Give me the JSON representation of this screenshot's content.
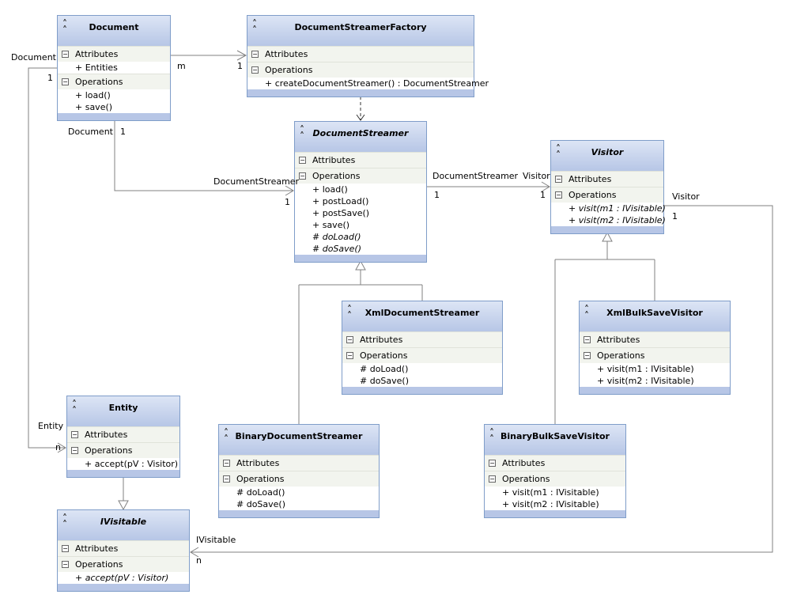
{
  "classes": [
    {
      "id": "document",
      "name": "Document",
      "abstract": false,
      "attributes_label": "Attributes",
      "attributes": [
        {
          "text": "+ Entities"
        }
      ],
      "operations_label": "Operations",
      "operations": [
        {
          "text": "+ load()"
        },
        {
          "text": "+ save()"
        }
      ]
    },
    {
      "id": "factory",
      "name": "DocumentStreamerFactory",
      "abstract": false,
      "attributes_label": "Attributes",
      "attributes": [],
      "operations_label": "Operations",
      "operations": [
        {
          "text": "+ createDocumentStreamer() : DocumentStreamer"
        }
      ]
    },
    {
      "id": "streamer",
      "name": "DocumentStreamer",
      "abstract": true,
      "attributes_label": "Attributes",
      "attributes": [],
      "operations_label": "Operations",
      "operations": [
        {
          "text": "+ load()"
        },
        {
          "text": "+ postLoad()"
        },
        {
          "text": "+ postSave()"
        },
        {
          "text": "+ save()"
        },
        {
          "text": "# doLoad()",
          "italic": true
        },
        {
          "text": "# doSave()",
          "italic": true
        }
      ]
    },
    {
      "id": "visitor",
      "name": "Visitor",
      "abstract": true,
      "attributes_label": "Attributes",
      "attributes": [],
      "operations_label": "Operations",
      "operations": [
        {
          "text": "+ visit(m1 : IVisitable)",
          "italic": true
        },
        {
          "text": "+ visit(m2 : IVisitable)",
          "italic": true
        }
      ]
    },
    {
      "id": "xmlstreamer",
      "name": "XmlDocumentStreamer",
      "abstract": false,
      "attributes_label": "Attributes",
      "attributes": [],
      "operations_label": "Operations",
      "operations": [
        {
          "text": "# doLoad()"
        },
        {
          "text": "# doSave()"
        }
      ]
    },
    {
      "id": "xmlvisitor",
      "name": "XmlBulkSaveVisitor",
      "abstract": false,
      "attributes_label": "Attributes",
      "attributes": [],
      "operations_label": "Operations",
      "operations": [
        {
          "text": "+ visit(m1 : IVisitable)"
        },
        {
          "text": "+ visit(m2 : IVisitable)"
        }
      ]
    },
    {
      "id": "entity",
      "name": "Entity",
      "abstract": false,
      "attributes_label": "Attributes",
      "attributes": [],
      "operations_label": "Operations",
      "operations": [
        {
          "text": "+ accept(pV : Visitor)"
        }
      ]
    },
    {
      "id": "binstreamer",
      "name": "BinaryDocumentStreamer",
      "abstract": false,
      "attributes_label": "Attributes",
      "attributes": [],
      "operations_label": "Operations",
      "operations": [
        {
          "text": "# doLoad()"
        },
        {
          "text": "# doSave()"
        }
      ]
    },
    {
      "id": "binvisitor",
      "name": "BinaryBulkSaveVisitor",
      "abstract": false,
      "attributes_label": "Attributes",
      "attributes": [],
      "operations_label": "Operations",
      "operations": [
        {
          "text": "+ visit(m1 : IVisitable)"
        },
        {
          "text": "+ visit(m2 : IVisitable)"
        }
      ]
    },
    {
      "id": "ivisitable",
      "name": "IVisitable",
      "abstract": true,
      "attributes_label": "Attributes",
      "attributes": [],
      "operations_label": "Operations",
      "operations": [
        {
          "text": "+ accept(pV : Visitor)",
          "italic": true
        }
      ]
    }
  ],
  "labels": [
    {
      "id": "m",
      "text": "m"
    },
    {
      "id": "f1",
      "text": "1"
    },
    {
      "id": "docA",
      "text": "Document"
    },
    {
      "id": "docA1",
      "text": "1"
    },
    {
      "id": "docB",
      "text": "Document"
    },
    {
      "id": "docB1",
      "text": "1"
    },
    {
      "id": "dsA",
      "text": "DocumentStreamer"
    },
    {
      "id": "dsA1",
      "text": "1"
    },
    {
      "id": "dsB",
      "text": "DocumentStreamer"
    },
    {
      "id": "dsB1",
      "text": "1"
    },
    {
      "id": "visA",
      "text": "Visitor"
    },
    {
      "id": "visA1",
      "text": "1"
    },
    {
      "id": "visB",
      "text": "Visitor"
    },
    {
      "id": "visB1",
      "text": "1"
    },
    {
      "id": "ent",
      "text": "Entity"
    },
    {
      "id": "entn",
      "text": "n"
    },
    {
      "id": "ivis",
      "text": "IVisitable"
    },
    {
      "id": "ivisn",
      "text": "n"
    }
  ],
  "colors": {
    "header_top": "#dde5f5",
    "header_bottom": "#b7c6e6",
    "border": "#7f9dc9",
    "line": "#808080"
  }
}
